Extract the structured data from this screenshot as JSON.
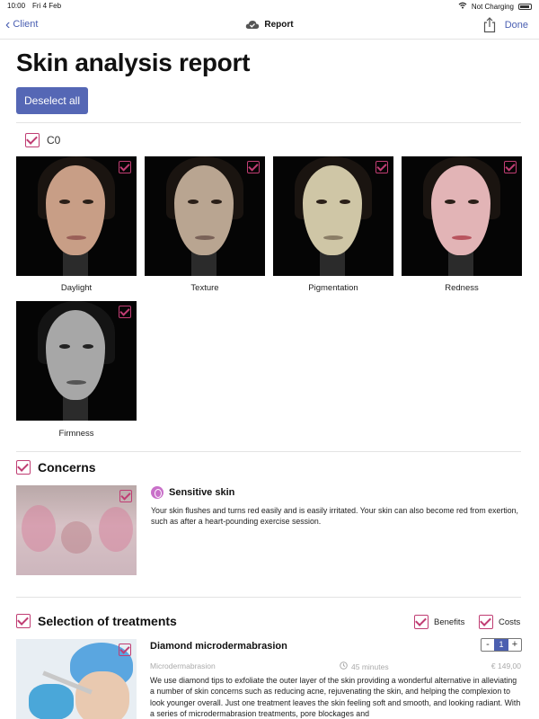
{
  "status_bar": {
    "time": "10:00",
    "date": "Fri 4 Feb",
    "charging": "Not Charging"
  },
  "nav": {
    "back_label": "Client",
    "title": "Report",
    "done_label": "Done"
  },
  "page": {
    "title": "Skin analysis report",
    "deselect_label": "Deselect all"
  },
  "analysis_group": {
    "label": "C0",
    "photos": [
      {
        "label": "Daylight"
      },
      {
        "label": "Texture"
      },
      {
        "label": "Pigmentation"
      },
      {
        "label": "Redness"
      },
      {
        "label": "Firmness"
      }
    ]
  },
  "concerns": {
    "heading": "Concerns",
    "item": {
      "title": "Sensitive skin",
      "description": "Your skin flushes and turns red easily and is easily irritated. Your skin can also become red from exertion, such as after a heart-pounding exercise session."
    }
  },
  "treatments": {
    "heading": "Selection of treatments",
    "benefits_label": "Benefits",
    "costs_label": "Costs",
    "item": {
      "title": "Diamond microdermabrasion",
      "quantity": "1",
      "category": "Microdermabrasion",
      "duration": "45 minutes",
      "price": "€ 149,00",
      "description": "We use diamond tips to exfoliate the outer layer of the skin providing a wonderful alternative in alleviating a number of skin concerns such as reducing acne, rejuvenating the skin, and helping the complexion to look younger overall. Just one treatment leaves the skin feeling soft and smooth, and looking radiant. With a series of microdermabrasion treatments, pore blockages and"
    }
  },
  "colors": {
    "accent": "#c03d73",
    "primary": "#5567b5",
    "link": "#4a5fb2"
  }
}
